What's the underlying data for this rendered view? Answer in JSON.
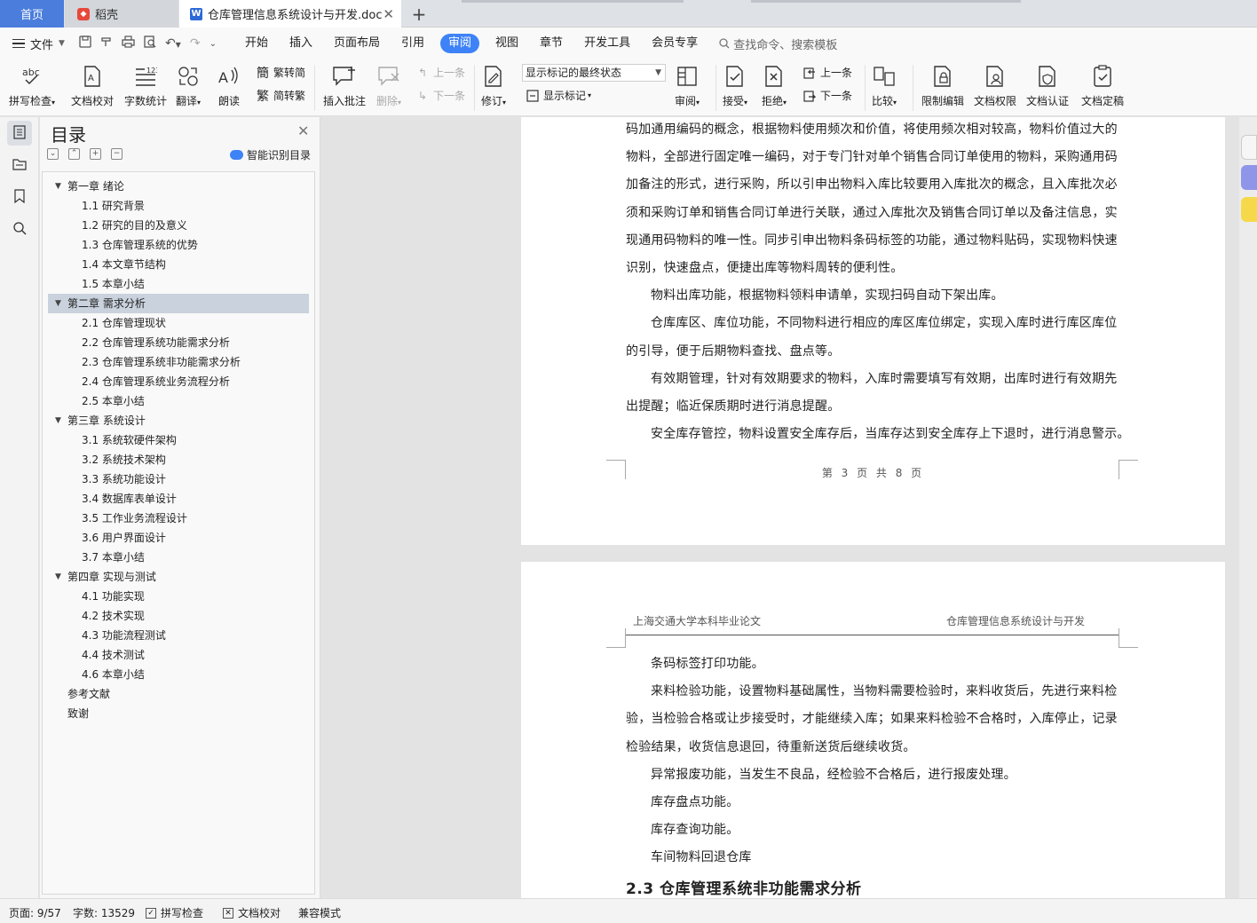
{
  "tabs": {
    "home": "首页",
    "daoke": "稻壳",
    "document": "仓库管理信息系统设计与开发.doc"
  },
  "menu": {
    "file": "文件",
    "items": [
      "开始",
      "插入",
      "页面布局",
      "引用",
      "审阅",
      "视图",
      "章节",
      "开发工具",
      "会员专享"
    ],
    "active": "审阅",
    "search_placeholder": "查找命令、搜索模板"
  },
  "ribbon": {
    "spell_check": "拼写检查",
    "doc_proof": "文档校对",
    "word_count": "字数统计",
    "translate": "翻译",
    "read_aloud": "朗读",
    "trad_to_simp": "繁转简",
    "simp_to_trad": "简转繁",
    "insert_comment": "插入批注",
    "delete": "删除",
    "prev_comment": "上一条",
    "next_comment": "下一条",
    "track_changes": "修订",
    "markup_state": "显示标记的最终状态",
    "show_markup": "显示标记",
    "review": "审阅",
    "accept": "接受",
    "reject": "拒绝",
    "prev_change": "上一条",
    "next_change": "下一条",
    "compare": "比较",
    "restrict_edit": "限制编辑",
    "doc_permission": "文档权限",
    "doc_certify": "文档认证",
    "doc_finalize": "文档定稿"
  },
  "toc": {
    "title": "目录",
    "smart_detect": "智能识别目录",
    "items": [
      {
        "level": 1,
        "text": "第一章  绪论"
      },
      {
        "level": 2,
        "text": "1.1  研究背景"
      },
      {
        "level": 2,
        "text": "1.2  研究的目的及意义"
      },
      {
        "level": 2,
        "text": "1.3  仓库管理系统的优势"
      },
      {
        "level": 2,
        "text": "1.4  本文章节结构"
      },
      {
        "level": 2,
        "text": "1.5 本章小结"
      },
      {
        "level": 1,
        "text": "第二章  需求分析",
        "selected": true
      },
      {
        "level": 2,
        "text": "2.1  仓库管理现状"
      },
      {
        "level": 2,
        "text": "2.2  仓库管理系统功能需求分析"
      },
      {
        "level": 2,
        "text": "2.3 仓库管理系统非功能需求分析"
      },
      {
        "level": 2,
        "text": "2.4 仓库管理系统业务流程分析"
      },
      {
        "level": 2,
        "text": "2.5 本章小结"
      },
      {
        "level": 1,
        "text": "第三章  系统设计"
      },
      {
        "level": 2,
        "text": "3.1  系统软硬件架构"
      },
      {
        "level": 2,
        "text": "3.2  系统技术架构"
      },
      {
        "level": 2,
        "text": "3.3 系统功能设计"
      },
      {
        "level": 2,
        "text": "3.4 数据库表单设计"
      },
      {
        "level": 2,
        "text": "3.5 工作业务流程设计"
      },
      {
        "level": 2,
        "text": "3.6  用户界面设计"
      },
      {
        "level": 2,
        "text": "3.7 本章小结"
      },
      {
        "level": 1,
        "text": "第四章  实现与测试"
      },
      {
        "level": 2,
        "text": "4.1  功能实现"
      },
      {
        "level": 2,
        "text": "4.2  技术实现"
      },
      {
        "level": 2,
        "text": "4.3 功能流程测试"
      },
      {
        "level": 2,
        "text": "4.4  技术测试"
      },
      {
        "level": 2,
        "text": "4.6 本章小结"
      },
      {
        "level": 0,
        "text": "参考文献"
      },
      {
        "level": 0,
        "text": "致谢"
      }
    ]
  },
  "page1": {
    "lines": [
      {
        "indent": false,
        "text": "码加通用编码的概念，根据物料使用频次和价值，将使用频次相对较高，物料价值过大的"
      },
      {
        "indent": false,
        "text": "物料，全部进行固定唯一编码，对于专门针对单个销售合同订单使用的物料，采购通用码"
      },
      {
        "indent": false,
        "text": "加备注的形式，进行采购，所以引申出物料入库比较要用入库批次的概念，且入库批次必"
      },
      {
        "indent": false,
        "text": "须和采购订单和销售合同订单进行关联，通过入库批次及销售合同订单以及备注信息，实"
      },
      {
        "indent": false,
        "text": "现通用码物料的唯一性。同步引申出物料条码标签的功能，通过物料贴码，实现物料快速"
      },
      {
        "indent": false,
        "text": "识别，快速盘点，便捷出库等物料周转的便利性。"
      },
      {
        "indent": true,
        "text": "物料出库功能，根据物料领料申请单，实现扫码自动下架出库。"
      },
      {
        "indent": true,
        "text": "仓库库区、库位功能，不同物料进行相应的库区库位绑定，实现入库时进行库区库位"
      },
      {
        "indent": false,
        "text": "的引导，便于后期物料查找、盘点等。"
      },
      {
        "indent": true,
        "text": "有效期管理，针对有效期要求的物料，入库时需要填写有效期，出库时进行有效期先"
      },
      {
        "indent": false,
        "text": "出提醒；临近保质期时进行消息提醒。"
      },
      {
        "indent": true,
        "text": "安全库存管控，物料设置安全库存后，当库存达到安全库存上下退时，进行消息警示。"
      }
    ],
    "footer": "第 3 页 共 8 页"
  },
  "page2": {
    "header_left": "上海交通大学本科毕业论文",
    "header_right": "仓库管理信息系统设计与开发",
    "lines": [
      {
        "indent": true,
        "text": "条码标签打印功能。"
      },
      {
        "indent": true,
        "text": "来料检验功能，设置物料基础属性，当物料需要检验时，来料收货后，先进行来料检"
      },
      {
        "indent": false,
        "text": "验，当检验合格或让步接受时，才能继续入库；如果来料检验不合格时，入库停止，记录"
      },
      {
        "indent": false,
        "text": "检验结果，收货信息退回，待重新送货后继续收货。"
      },
      {
        "indent": true,
        "text": "异常报废功能，当发生不良品，经检验不合格后，进行报废处理。"
      },
      {
        "indent": true,
        "text": "库存盘点功能。"
      },
      {
        "indent": true,
        "text": "库存查询功能。"
      },
      {
        "indent": true,
        "text": "车间物料回退仓库"
      }
    ],
    "heading": "2.3 仓库管理系统非功能需求分析"
  },
  "status": {
    "page": "页面: 9/57",
    "word_count": "字数: 13529",
    "spell_check": "拼写检查",
    "doc_proof": "文档校对",
    "compat_mode": "兼容模式"
  },
  "colors": {
    "accent": "#3e82f7",
    "home_tab": "#4a7ddc",
    "toc_selected": "#c9d2dd"
  }
}
